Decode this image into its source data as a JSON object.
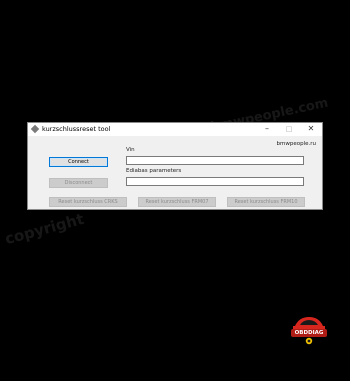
{
  "window": {
    "title": "kurzschlussreset tool",
    "site_label": "bmwpeople.ru",
    "controls": {
      "minimize": "–",
      "maximize": "□",
      "close": "✕"
    }
  },
  "form": {
    "vin_label": "Vin",
    "vin_value": "",
    "ediabas_label": "Ediabas parameters",
    "ediabas_value": ""
  },
  "buttons": {
    "connect": "Connect",
    "disconnect": "Disconnect",
    "reset_1": "Reset kurzschluss CRKS",
    "reset_2": "Reset kurzschluss FRM07",
    "reset_3": "Reset kurzschluss FRM10"
  },
  "watermark": {
    "text_left": "copyright",
    "text_top": "www.bmwpeople.com"
  },
  "logo": {
    "text": "OBDDIAG",
    "colors": {
      "primary": "#d7261e",
      "secondary": "#f2c200"
    }
  }
}
